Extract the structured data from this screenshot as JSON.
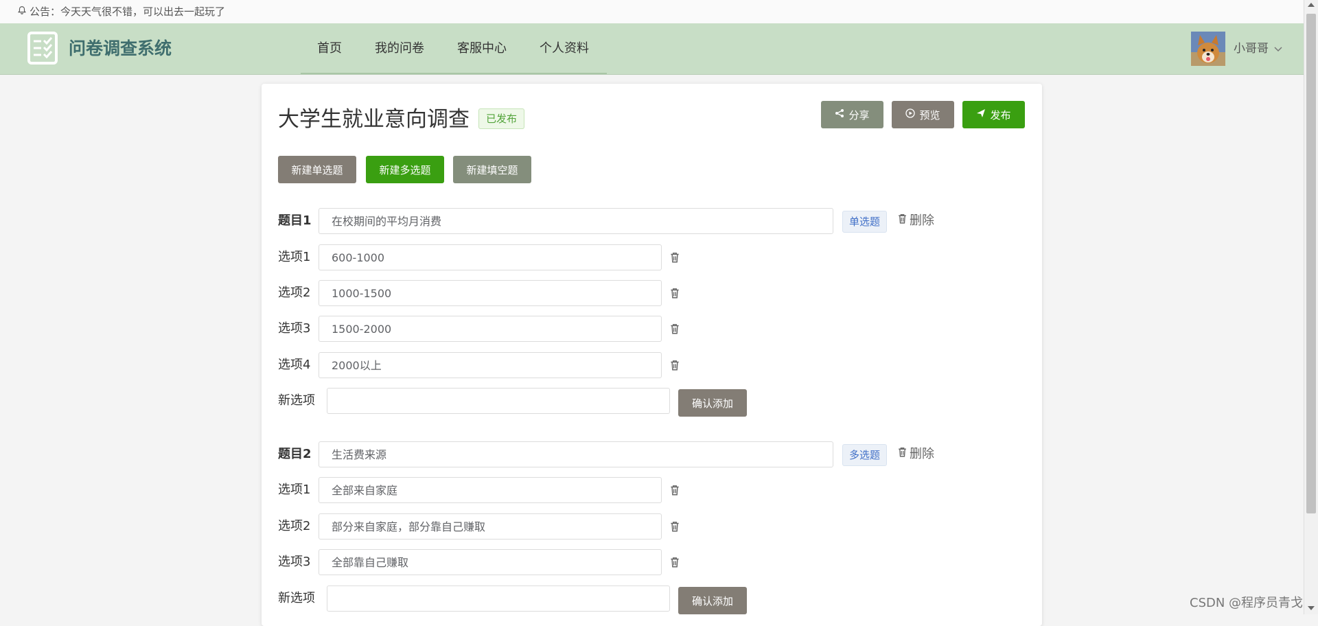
{
  "announcement": "公告：今天天气很不错，可以出去一起玩了",
  "header": {
    "brand": "问卷调查系统",
    "nav": [
      "首页",
      "我的问卷",
      "客服中心",
      "个人资料"
    ],
    "username": "小哥哥"
  },
  "survey": {
    "title": "大学生就业意向调查",
    "status": "已发布",
    "actions": {
      "share": "分享",
      "preview": "预览",
      "publish": "发布"
    },
    "create_buttons": {
      "single": "新建单选题",
      "multi": "新建多选题",
      "fill": "新建填空题"
    },
    "delete_label": "删除",
    "new_option_label": "新选项",
    "new_option_value": "",
    "confirm_add": "确认添加",
    "questions": [
      {
        "label": "题目1",
        "text": "在校期间的平均月消费",
        "type": "单选题",
        "options": [
          {
            "label": "选项1",
            "value": "600-1000"
          },
          {
            "label": "选项2",
            "value": "1000-1500"
          },
          {
            "label": "选项3",
            "value": "1500-2000"
          },
          {
            "label": "选项4",
            "value": "2000以上"
          }
        ]
      },
      {
        "label": "题目2",
        "text": "生活费来源",
        "type": "多选题",
        "options": [
          {
            "label": "选项1",
            "value": "全部来自家庭"
          },
          {
            "label": "选项2",
            "value": "部分来自家庭，部分靠自己赚取"
          },
          {
            "label": "选项3",
            "value": "全部靠自己赚取"
          }
        ]
      }
    ]
  },
  "watermark": "CSDN @程序员青戈",
  "colors": {
    "header_bg": "#c8dec6",
    "brand_text": "#3f6e6e",
    "primary_green": "#3a9f11",
    "gray_green": "#848e7c",
    "gray_brown": "#837d75"
  }
}
